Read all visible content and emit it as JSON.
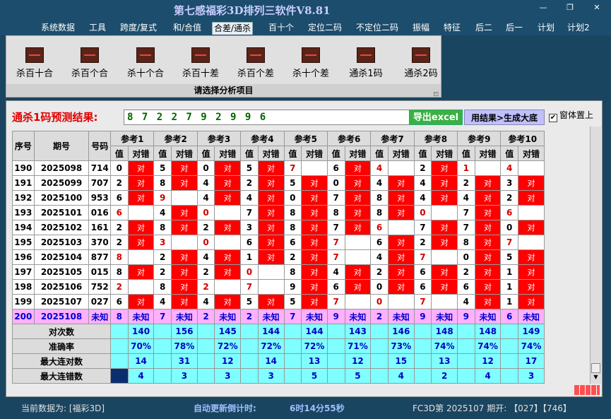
{
  "app": {
    "title": "第七感福彩3D排列三软件V8.81"
  },
  "menu": [
    "系统数据",
    "工具",
    "跨度/复式",
    "和/合值",
    "合差/通杀",
    "百十个",
    "定位二码",
    "不定位二码",
    "振幅",
    "特征",
    "后二",
    "后一",
    "计划",
    "计划2"
  ],
  "menu_active_index": 4,
  "ribbon": {
    "items": [
      "杀百十合",
      "杀百个合",
      "杀十个合",
      "杀百十差",
      "杀百个差",
      "杀十个差",
      "通杀1码",
      "通杀2码"
    ],
    "footer": "请选择分析项目"
  },
  "prediction": {
    "label": "通杀1码预测结果:",
    "value": "8 7 2 2 7 9 2 9 9 6",
    "export_btn": "导出excel",
    "gen_btn": "用结果>生成大底",
    "checkbox_label": "窗体置上",
    "checkbox_checked": true
  },
  "table": {
    "headers": {
      "seq": "序号",
      "period": "期号",
      "num": "号码"
    },
    "ref_headers": [
      "参考1",
      "参考2",
      "参考3",
      "参考4",
      "参考5",
      "参考6",
      "参考7",
      "参考8",
      "参考9",
      "参考10"
    ],
    "sub_value": "值",
    "sub_result": "对错",
    "hit_text": "对",
    "rows": [
      {
        "seq": "190",
        "period": "2025098",
        "num": "714",
        "v": [
          "0",
          "5",
          "0",
          "5",
          "7",
          "6",
          "4",
          "2",
          "1",
          "4"
        ],
        "r": [
          1,
          1,
          1,
          1,
          0,
          1,
          0,
          1,
          0,
          0
        ]
      },
      {
        "seq": "191",
        "period": "2025099",
        "num": "707",
        "v": [
          "2",
          "8",
          "4",
          "2",
          "5",
          "0",
          "4",
          "4",
          "2",
          "3"
        ],
        "r": [
          1,
          1,
          1,
          1,
          1,
          1,
          1,
          1,
          1,
          1
        ]
      },
      {
        "seq": "192",
        "period": "2025100",
        "num": "953",
        "v": [
          "6",
          "9",
          "4",
          "4",
          "0",
          "7",
          "8",
          "4",
          "4",
          "2"
        ],
        "r": [
          1,
          0,
          1,
          1,
          1,
          1,
          1,
          1,
          1,
          1
        ]
      },
      {
        "seq": "193",
        "period": "2025101",
        "num": "016",
        "v": [
          "6",
          "4",
          "0",
          "7",
          "8",
          "8",
          "8",
          "0",
          "7",
          "6"
        ],
        "r": [
          0,
          1,
          0,
          1,
          1,
          1,
          1,
          0,
          1,
          0
        ]
      },
      {
        "seq": "194",
        "period": "2025102",
        "num": "161",
        "v": [
          "2",
          "8",
          "2",
          "3",
          "8",
          "7",
          "6",
          "7",
          "7",
          "0"
        ],
        "r": [
          1,
          1,
          1,
          1,
          1,
          1,
          0,
          1,
          1,
          1
        ]
      },
      {
        "seq": "195",
        "period": "2025103",
        "num": "370",
        "v": [
          "2",
          "3",
          "0",
          "6",
          "6",
          "7",
          "6",
          "2",
          "8",
          "7"
        ],
        "r": [
          1,
          0,
          0,
          1,
          1,
          0,
          1,
          1,
          1,
          0
        ]
      },
      {
        "seq": "196",
        "period": "2025104",
        "num": "877",
        "v": [
          "8",
          "2",
          "4",
          "1",
          "2",
          "7",
          "4",
          "7",
          "0",
          "5"
        ],
        "r": [
          0,
          1,
          1,
          1,
          1,
          0,
          1,
          0,
          1,
          1
        ]
      },
      {
        "seq": "197",
        "period": "2025105",
        "num": "015",
        "v": [
          "8",
          "2",
          "2",
          "0",
          "8",
          "4",
          "2",
          "6",
          "2",
          "1"
        ],
        "r": [
          1,
          1,
          1,
          0,
          1,
          1,
          1,
          1,
          1,
          1
        ]
      },
      {
        "seq": "198",
        "period": "2025106",
        "num": "752",
        "v": [
          "2",
          "8",
          "2",
          "7",
          "9",
          "6",
          "0",
          "6",
          "6",
          "1"
        ],
        "r": [
          0,
          1,
          0,
          0,
          1,
          1,
          1,
          1,
          1,
          1
        ]
      },
      {
        "seq": "199",
        "period": "2025107",
        "num": "027",
        "v": [
          "6",
          "4",
          "4",
          "5",
          "5",
          "7",
          "0",
          "7",
          "4",
          "1"
        ],
        "r": [
          1,
          1,
          1,
          1,
          1,
          0,
          0,
          0,
          1,
          1
        ]
      }
    ],
    "unknown_row": {
      "seq": "200",
      "period": "2025108",
      "num": "未知",
      "v": [
        "8",
        "7",
        "2",
        "2",
        "7",
        "9",
        "2",
        "9",
        "9",
        "6"
      ],
      "result": "未知"
    },
    "stats": [
      {
        "label": "对次数",
        "values": [
          "140",
          "156",
          "145",
          "144",
          "144",
          "143",
          "146",
          "148",
          "148",
          "149"
        ]
      },
      {
        "label": "准确率",
        "values": [
          "70%",
          "78%",
          "72%",
          "72%",
          "72%",
          "71%",
          "73%",
          "74%",
          "74%",
          "74%"
        ]
      },
      {
        "label": "最大连对数",
        "values": [
          "14",
          "31",
          "12",
          "14",
          "13",
          "12",
          "15",
          "13",
          "12",
          "17"
        ]
      },
      {
        "label": "最大连错数",
        "values": [
          "4",
          "3",
          "3",
          "3",
          "5",
          "5",
          "4",
          "2",
          "4",
          "3"
        ]
      }
    ]
  },
  "status": {
    "current": "当前数据为: [福彩3D]",
    "countdown_label": "自动更新倒计时:",
    "countdown_value": "6时14分55秒",
    "draw": "FC3D第 2025107 期开: 【027】【746】"
  },
  "colors": {
    "hit": "#ff0000",
    "miss": "#ffffff",
    "stat_bg": "#7fffff",
    "unknown_bg": "#ffb0ff",
    "accent_green": "#3cb043"
  }
}
